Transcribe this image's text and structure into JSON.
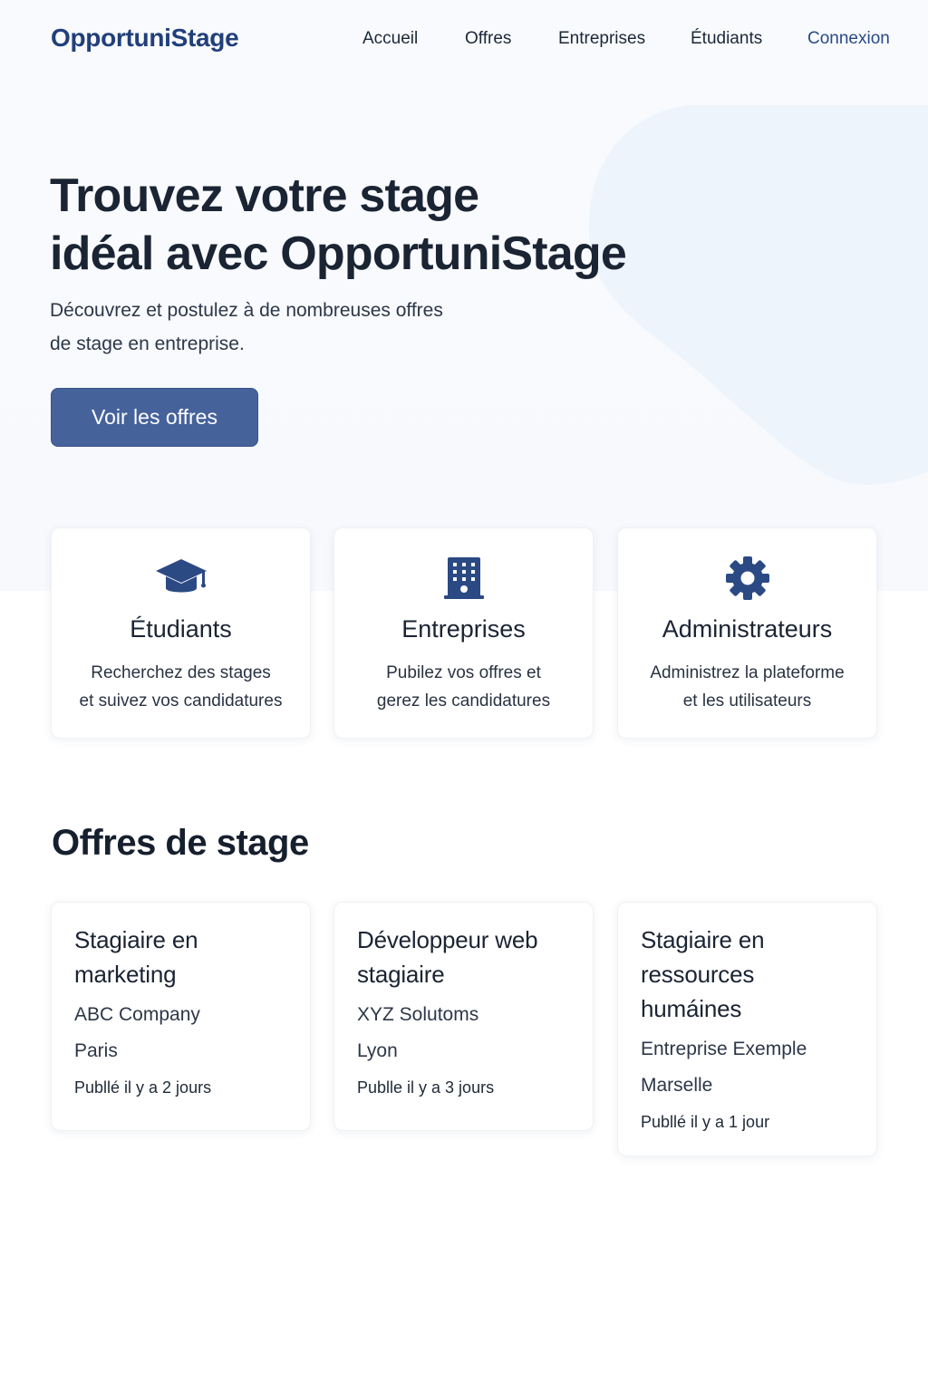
{
  "brand": {
    "name": "OpportuniStage"
  },
  "nav": {
    "items": [
      "Accueil",
      "Offres",
      "Entreprises",
      "Étudiants"
    ],
    "login": "Connexion"
  },
  "hero": {
    "title_line1": "Trouvez votre stage",
    "title_line2": "idéal avec OpportuniStage",
    "subtitle_line1": "Découvrez et postulez à de nombreuses offres",
    "subtitle_line2": "de stage en entreprise.",
    "cta_label": "Voir les offres"
  },
  "features": [
    {
      "icon": "graduation-cap-icon",
      "title": "Étudiants",
      "desc_line1": "Recherchez des stages",
      "desc_line2": "et suivez vos candidatures"
    },
    {
      "icon": "building-icon",
      "title": "Entreprises",
      "desc_line1": "Pubilez vos offres et",
      "desc_line2": "gerez les candidatures"
    },
    {
      "icon": "gear-icon",
      "title": "Administrateurs",
      "desc_line1": "Administrez la plateforme",
      "desc_line2": "et les utilisateurs"
    }
  ],
  "offers_section": {
    "title": "Offres de stage",
    "offers": [
      {
        "title_line1": "Stagiaire en",
        "title_line2": "marketing",
        "title_line3": "",
        "company": "ABC Company",
        "city": "Paris",
        "posted": "Publlé il y a 2 jours"
      },
      {
        "title_line1": "Développeur web",
        "title_line2": "stagiaire",
        "title_line3": "",
        "company": "XYZ Solutoms",
        "city": "Lyon",
        "posted": "Publle il y a 3 jours"
      },
      {
        "title_line1": "Stagiaire en",
        "title_line2": "ressources",
        "title_line3": "humáines",
        "company": "Entreprise Exemple",
        "city": "Marselle",
        "posted": "Publlé il y a 1 jour"
      }
    ]
  },
  "colors": {
    "brand": "#213f7a",
    "accent": "#46629b",
    "icon": "#2b4a84",
    "blob": "#eef4fc"
  }
}
